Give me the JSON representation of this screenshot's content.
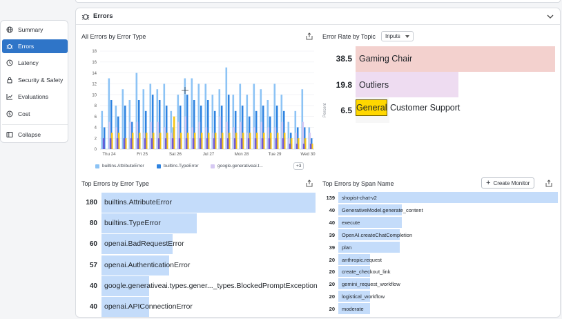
{
  "sidebar": {
    "items": [
      {
        "label": "Summary",
        "icon": "globe-icon",
        "active": false
      },
      {
        "label": "Errors",
        "icon": "bug-icon",
        "active": true
      },
      {
        "label": "Latency",
        "icon": "clock-icon",
        "active": false
      },
      {
        "label": "Security & Safety",
        "icon": "lock-icon",
        "active": false
      },
      {
        "label": "Evaluations",
        "icon": "chart-icon",
        "active": false
      },
      {
        "label": "Cost",
        "icon": "dollar-icon",
        "active": false
      }
    ],
    "collapse_label": "Collapse"
  },
  "section": {
    "title": "Errors"
  },
  "errors_by_type_chart": {
    "title": "All Errors by Error Type",
    "legend": [
      "builtins.AttributeError",
      "builtins.TypeError",
      "google.generativeai.t..."
    ],
    "legend_more": "+3",
    "colors": {
      "light_blue": "#8cc3f5",
      "blue": "#2e83e0",
      "lavender": "#d6c9f3",
      "yellow": "#f5c518",
      "purple": "#6e5bd6"
    }
  },
  "chart_data": {
    "type": "bar",
    "stacked": false,
    "y_ticks": [
      "0",
      "2",
      "4",
      "6",
      "8",
      "10",
      "12",
      "14",
      "16",
      "18"
    ],
    "ylim": [
      0,
      18
    ],
    "x_ticks": [
      "Thu 24",
      "Fri 25",
      "Sat 26",
      "Jul 27",
      "Mon 28",
      "Tue 29",
      "Wed 30"
    ],
    "groups": [
      {
        "light_blue": 7,
        "blue": 4,
        "lavender": 0,
        "yellow": 0,
        "purple": 2
      },
      {
        "light_blue": 13,
        "blue": 9,
        "lavender": 5,
        "yellow": 3,
        "purple": 2
      },
      {
        "light_blue": 8,
        "blue": 6,
        "lavender": 4,
        "yellow": 3,
        "purple": 2
      },
      {
        "light_blue": 11,
        "blue": 8,
        "lavender": 0,
        "yellow": 2,
        "purple": 2
      },
      {
        "light_blue": 9,
        "blue": 5,
        "lavender": 5,
        "yellow": 3,
        "purple": 2
      },
      {
        "light_blue": 14,
        "blue": 9,
        "lavender": 5,
        "yellow": 3,
        "purple": 2
      },
      {
        "light_blue": 11,
        "blue": 7,
        "lavender": 3,
        "yellow": 3,
        "purple": 2
      },
      {
        "light_blue": 12,
        "blue": 10,
        "lavender": 5,
        "yellow": 3,
        "purple": 2
      },
      {
        "light_blue": 11,
        "blue": 9,
        "lavender": 5,
        "yellow": 3,
        "purple": 2
      },
      {
        "light_blue": 12,
        "blue": 8,
        "lavender": 4,
        "yellow": 3,
        "purple": 2
      },
      {
        "light_blue": 7,
        "blue": 4,
        "lavender": 3,
        "yellow": 6,
        "purple": 2
      },
      {
        "light_blue": 10,
        "blue": 8,
        "lavender": 5,
        "yellow": 3,
        "purple": 2
      },
      {
        "light_blue": 13,
        "blue": 10,
        "lavender": 6,
        "yellow": 3,
        "purple": 2
      },
      {
        "light_blue": 13,
        "blue": 9,
        "lavender": 4,
        "yellow": 3,
        "purple": 2
      },
      {
        "light_blue": 12,
        "blue": 8,
        "lavender": 5,
        "yellow": 3,
        "purple": 2
      },
      {
        "light_blue": 12,
        "blue": 9,
        "lavender": 4,
        "yellow": 3,
        "purple": 2
      },
      {
        "light_blue": 10,
        "blue": 7,
        "lavender": 3,
        "yellow": 3,
        "purple": 2
      },
      {
        "light_blue": 11,
        "blue": 8,
        "lavender": 6,
        "yellow": 3,
        "purple": 2
      },
      {
        "light_blue": 15,
        "blue": 10,
        "lavender": 5,
        "yellow": 3,
        "purple": 2
      },
      {
        "light_blue": 10,
        "blue": 7,
        "lavender": 4,
        "yellow": 3,
        "purple": 2
      },
      {
        "light_blue": 12,
        "blue": 8,
        "lavender": 5,
        "yellow": 3,
        "purple": 2
      },
      {
        "light_blue": 10,
        "blue": 6,
        "lavender": 3,
        "yellow": 3,
        "purple": 2
      },
      {
        "light_blue": 12,
        "blue": 7,
        "lavender": 4,
        "yellow": 3,
        "purple": 2
      },
      {
        "light_blue": 11,
        "blue": 8,
        "lavender": 5,
        "yellow": 3,
        "purple": 2
      },
      {
        "light_blue": 9,
        "blue": 6,
        "lavender": 4,
        "yellow": 3,
        "purple": 2
      },
      {
        "light_blue": 12,
        "blue": 8,
        "lavender": 4,
        "yellow": 3,
        "purple": 2
      },
      {
        "light_blue": 10,
        "blue": 7,
        "lavender": 5,
        "yellow": 3,
        "purple": 2
      },
      {
        "light_blue": 5,
        "blue": 3,
        "lavender": 2,
        "yellow": 2,
        "purple": 1
      },
      {
        "light_blue": 7,
        "blue": 4,
        "lavender": 3,
        "yellow": 2,
        "purple": 1
      },
      {
        "light_blue": 11,
        "blue": 4,
        "lavender": 5,
        "yellow": 2,
        "purple": 1
      },
      {
        "light_blue": 4,
        "blue": 2,
        "lavender": 3,
        "yellow": 1,
        "purple": 1
      }
    ]
  },
  "error_rate_by_topic": {
    "title": "Error Rate by Topic",
    "dropdown": "Inputs",
    "axis_label": "Percent",
    "rows": [
      {
        "value": "38.5",
        "label": "Gaming Chair",
        "fraction": 1.0,
        "color": "#f3d1ce"
      },
      {
        "value": "19.8",
        "label": "Outliers",
        "fraction": 0.514,
        "color": "#eedcf1"
      },
      {
        "value": "6.5",
        "label_highlight": "General",
        "label_rest": " Customer Support",
        "fraction": 0.169,
        "color": "#f7f7f7"
      }
    ]
  },
  "top_errors_by_type": {
    "title": "Top Errors by Error Type",
    "rows": [
      {
        "value": "180",
        "label": "builtins.AttributeError",
        "fraction": 1.0
      },
      {
        "value": "80",
        "label": "builtins.TypeError",
        "fraction": 0.444
      },
      {
        "value": "60",
        "label": "openai.BadRequestError",
        "fraction": 0.333
      },
      {
        "value": "57",
        "label": "openai.AuthenticationError",
        "fraction": 0.317
      },
      {
        "value": "40",
        "label": "google.generativeai.types.gener..._types.BlockedPromptException",
        "fraction": 0.222
      },
      {
        "value": "40",
        "label": "openai.APIConnectionError",
        "fraction": 0.222
      }
    ]
  },
  "top_errors_by_span": {
    "title": "Top Errors by Span Name",
    "create_monitor": "Create Monitor",
    "rows": [
      {
        "value": "139",
        "label": "shopist-chat-v2",
        "fraction": 1.0
      },
      {
        "value": "40",
        "label": "GenerativeModel.generate_content",
        "fraction": 0.288
      },
      {
        "value": "40",
        "label": "execute",
        "fraction": 0.288
      },
      {
        "value": "39",
        "label": "OpenAI.createChatCompletion",
        "fraction": 0.281
      },
      {
        "value": "39",
        "label": "plan",
        "fraction": 0.281
      },
      {
        "value": "20",
        "label": "anthropic.request",
        "fraction": 0.144
      },
      {
        "value": "20",
        "label": "create_checkout_link",
        "fraction": 0.144
      },
      {
        "value": "20",
        "label": "gemini_request_workflow",
        "fraction": 0.144
      },
      {
        "value": "20",
        "label": "logistical_workflow",
        "fraction": 0.144
      },
      {
        "value": "20",
        "label": "moderate",
        "fraction": 0.144
      }
    ]
  }
}
